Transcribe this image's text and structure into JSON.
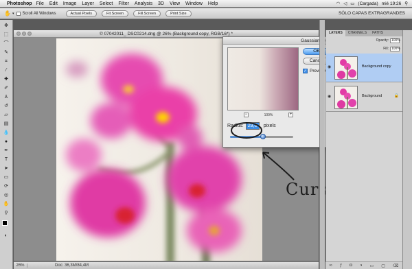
{
  "menubar": {
    "app_name": "Photoshop",
    "items": [
      "File",
      "Edit",
      "Image",
      "Layer",
      "Select",
      "Filter",
      "Analysis",
      "3D",
      "View",
      "Window",
      "Help"
    ],
    "status_charge": "(Cargada)",
    "clock": "mié 19:26"
  },
  "options_bar": {
    "scroll_all_label": "Scroll All Windows",
    "buttons": [
      "Actual Pixels",
      "Fit Screen",
      "Fill Screen",
      "Print Size"
    ],
    "workspace": "SÓLO CAPAS EXTRAGRANDES"
  },
  "document": {
    "title": "© 07042011_ DSC0214.dng @ 26% (Background copy, RGB/16*) *",
    "zoom": "26%",
    "status": "Doc: 36,3M/84,4M"
  },
  "dialog": {
    "title": "Gaussian Blur",
    "ok_label": "OK",
    "cancel_label": "Cancel",
    "preview_label": "Preview",
    "preview_checked": true,
    "zoom_level": "100%",
    "zoom_out": "−",
    "zoom_in": "+",
    "radius_label": "Radius:",
    "radius_value": "29,0",
    "radius_unit": "pixels",
    "radius_slider_fraction": 0.52
  },
  "layers_panel": {
    "tabs": [
      "LAYERS",
      "CHANNELS",
      "PATHS"
    ],
    "opacity_label": "Opacity:",
    "opacity_value": "100%",
    "fill_label": "Fill:",
    "fill_value": "100%",
    "layers": [
      {
        "name": "Background copy",
        "selected": true
      },
      {
        "name": "Background",
        "selected": false
      }
    ]
  },
  "annotation": {
    "text": "Cursor"
  },
  "colors": {
    "accent_blue": "#3c8ee6",
    "orchid_pink": "#e23ba5"
  }
}
